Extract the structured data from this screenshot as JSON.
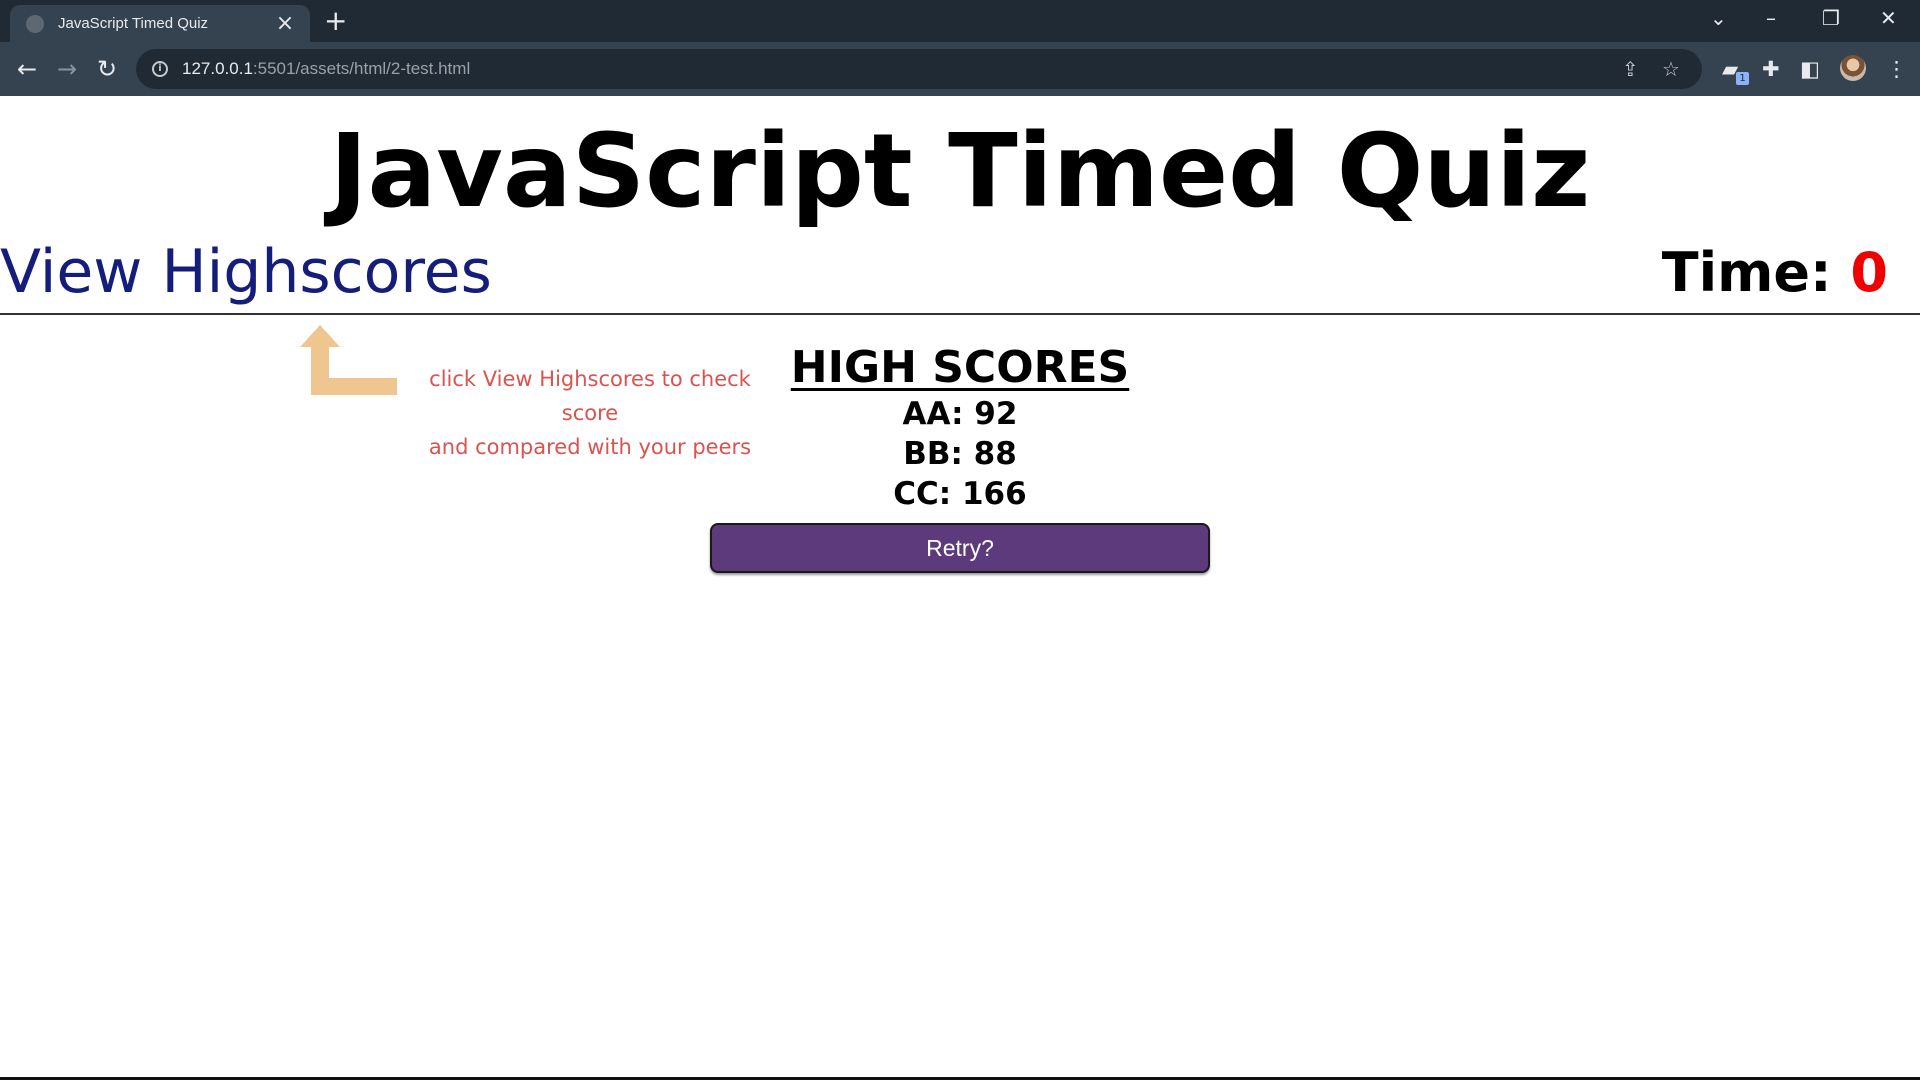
{
  "browser": {
    "tab_title": "JavaScript Timed Quiz",
    "url_host": "127.0.0.1",
    "url_path": ":5501/assets/html/2-test.html",
    "extension_badge": "1"
  },
  "page": {
    "title": "JavaScript Timed Quiz",
    "highscores_link": "View Highscores",
    "timer_label": "Time:",
    "timer_value": "0"
  },
  "hint": {
    "line1": "click View Highscores to check score",
    "line2": "and compared with your peers"
  },
  "scores": {
    "title": "HIGH SCORES",
    "items": [
      "AA: 92",
      "BB: 88",
      "CC: 166"
    ]
  },
  "retry_label": "Retry?",
  "colors": {
    "link": "#141e7a",
    "timer_value": "#f00000",
    "hint_text": "#d9534f",
    "hint_arrow": "#f0c690",
    "retry_button": "#5d3a7c"
  }
}
